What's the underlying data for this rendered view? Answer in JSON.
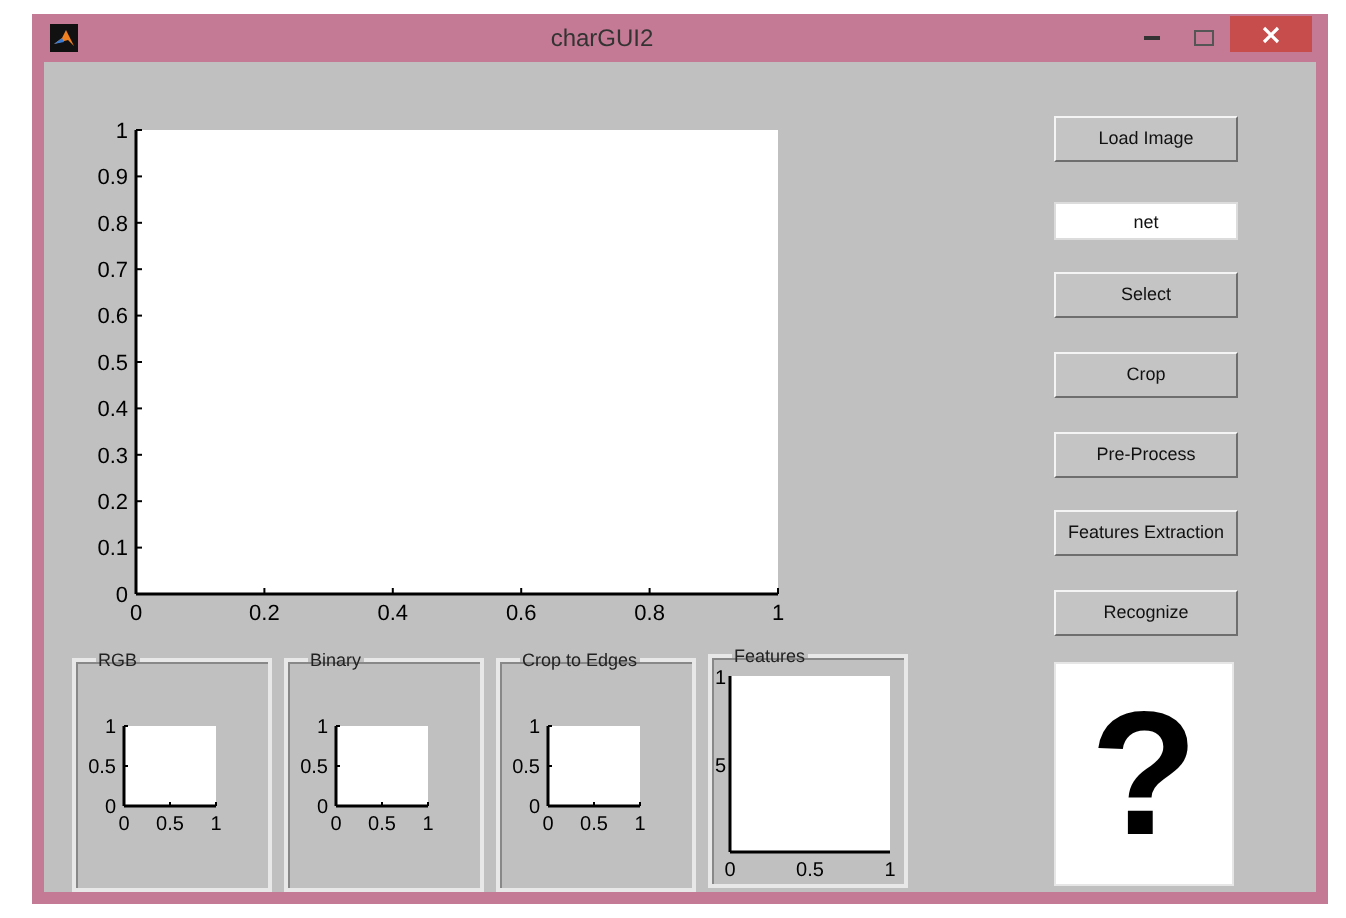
{
  "window": {
    "title": "charGUI2"
  },
  "main_axes": {
    "chart_data": {
      "type": "line",
      "xlim": [
        0,
        1
      ],
      "ylim": [
        0,
        1
      ],
      "xticks": [
        0,
        0.2,
        0.4,
        0.6,
        0.8,
        1
      ],
      "yticks": [
        0,
        0.1,
        0.2,
        0.3,
        0.4,
        0.5,
        0.6,
        0.7,
        0.8,
        0.9,
        1
      ]
    }
  },
  "panels": [
    {
      "title": "RGB",
      "kind": "small",
      "chart_data": {
        "type": "line",
        "xlim": [
          0,
          1
        ],
        "ylim": [
          0,
          1
        ],
        "xticks": [
          0,
          0.5,
          1
        ],
        "yticks": [
          0,
          0.5,
          1
        ]
      }
    },
    {
      "title": "Binary",
      "kind": "small",
      "chart_data": {
        "type": "line",
        "xlim": [
          0,
          1
        ],
        "ylim": [
          0,
          1
        ],
        "xticks": [
          0,
          0.5,
          1
        ],
        "yticks": [
          0,
          0.5,
          1
        ]
      }
    },
    {
      "title": "Crop to Edges",
      "kind": "small",
      "chart_data": {
        "type": "line",
        "xlim": [
          0,
          1
        ],
        "ylim": [
          0,
          1
        ],
        "xticks": [
          0,
          0.5,
          1
        ],
        "yticks": [
          0,
          0.5,
          1
        ]
      }
    },
    {
      "title": "Features",
      "kind": "large",
      "y_tick_labels": [
        "1",
        "5"
      ],
      "x_tick_labels": [
        "0",
        "0.5",
        "1"
      ]
    }
  ],
  "controls": [
    {
      "kind": "button",
      "label": "Load Image"
    },
    {
      "kind": "field",
      "value": "net"
    },
    {
      "kind": "button",
      "label": "Select"
    },
    {
      "kind": "button",
      "label": "Crop"
    },
    {
      "kind": "button",
      "label": "Pre-Process"
    },
    {
      "kind": "button",
      "label": "Features Extraction"
    },
    {
      "kind": "button",
      "label": "Recognize"
    }
  ],
  "result": {
    "text": "?"
  }
}
